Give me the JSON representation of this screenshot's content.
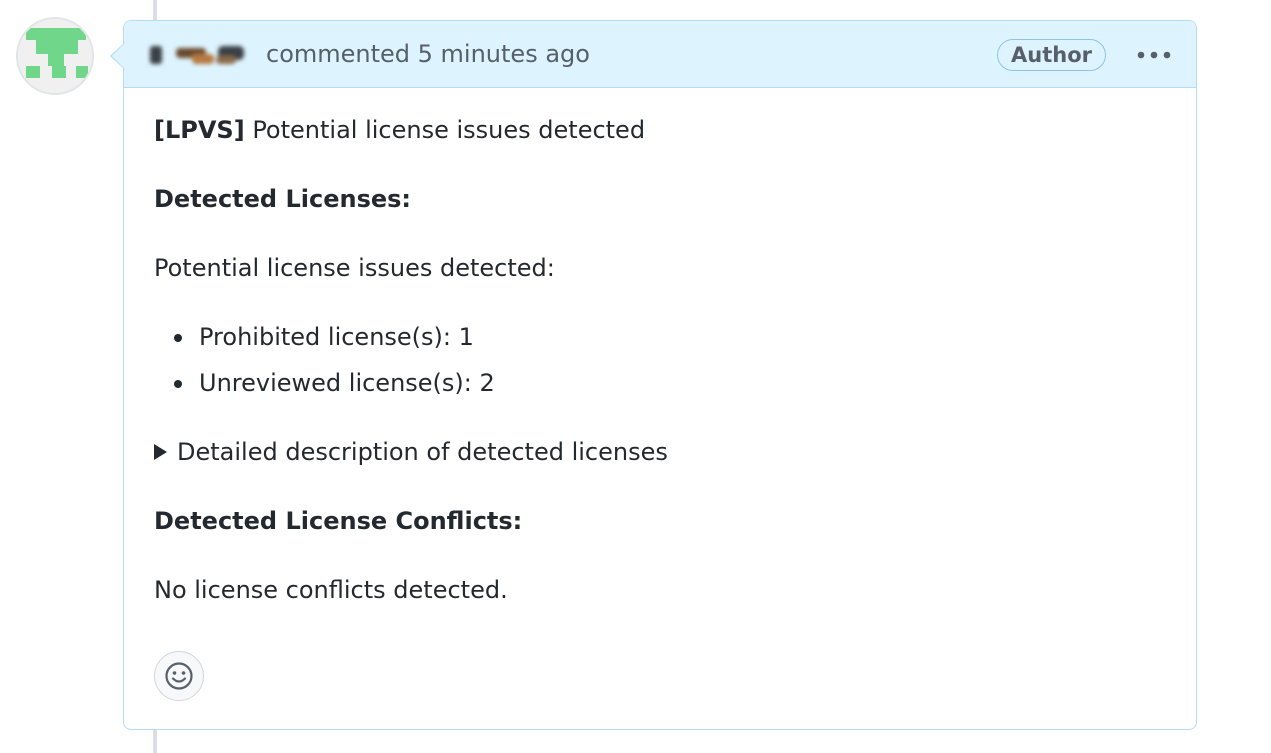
{
  "comment": {
    "header": {
      "meta_text": "commented 5 minutes ago",
      "author_badge": "Author"
    },
    "body": {
      "title_prefix": "[LPVS]",
      "title_rest": " Potential license issues detected",
      "detected_licenses_heading": "Detected Licenses:",
      "issues_intro": "Potential license issues detected:",
      "bullets": [
        "Prohibited license(s): 1",
        "Unreviewed license(s): 2"
      ],
      "details_summary": "Detailed description of detected licenses",
      "conflicts_heading": "Detected License Conflicts:",
      "conflicts_text": "No license conflicts detected."
    }
  },
  "icons": {
    "avatar": "identicon-avatar",
    "kebab": "kebab-horizontal-icon",
    "reaction": "smiley-icon",
    "details": "triangle-right-icon"
  },
  "colors": {
    "header_bg": "#ddf4ff",
    "border": "#b6dcf3",
    "identicon": "#6fd68a",
    "timeline": "#d8dee4"
  }
}
